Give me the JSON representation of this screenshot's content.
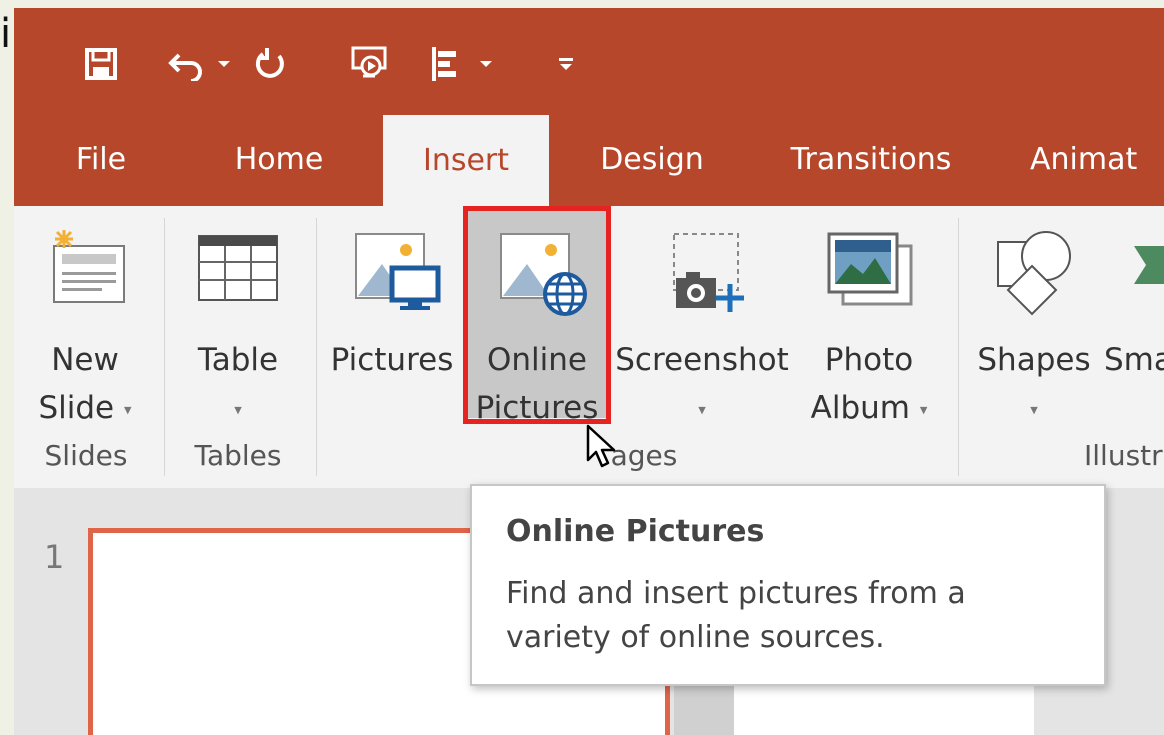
{
  "stray_glyph": "i",
  "quick_access": {
    "icons": [
      "save-icon",
      "undo-icon",
      "redo-icon",
      "start-from-beginning-icon",
      "touch-mouse-mode-icon",
      "customize-qat-icon"
    ]
  },
  "tabs": [
    {
      "label": "File",
      "active": false
    },
    {
      "label": "Home",
      "active": false
    },
    {
      "label": "Insert",
      "active": true
    },
    {
      "label": "Design",
      "active": false
    },
    {
      "label": "Transitions",
      "active": false
    },
    {
      "label": "Animat",
      "active": false
    }
  ],
  "ribbon": {
    "new_slide": {
      "line1": "New",
      "line2": "Slide"
    },
    "table": {
      "line1": "Table"
    },
    "pictures": {
      "line1": "Pictures"
    },
    "online_pictures": {
      "line1": "Online",
      "line2": "Pictures"
    },
    "screenshot": {
      "line1": "Screenshot"
    },
    "photo_album": {
      "line1": "Photo",
      "line2": "Album"
    },
    "shapes": {
      "line1": "Shapes"
    },
    "smartart": {
      "line1": "Sma"
    },
    "groups": {
      "slides": "Slides",
      "tables": "Tables",
      "images": "ages",
      "illustrations": "Illustr"
    }
  },
  "tooltip": {
    "title": "Online Pictures",
    "body": "Find and insert pictures from a variety of online sources."
  },
  "slide_panel": {
    "number": "1"
  },
  "colors": {
    "accent": "#b7472a",
    "highlight": "#e52320",
    "slide_border": "#e06448"
  }
}
